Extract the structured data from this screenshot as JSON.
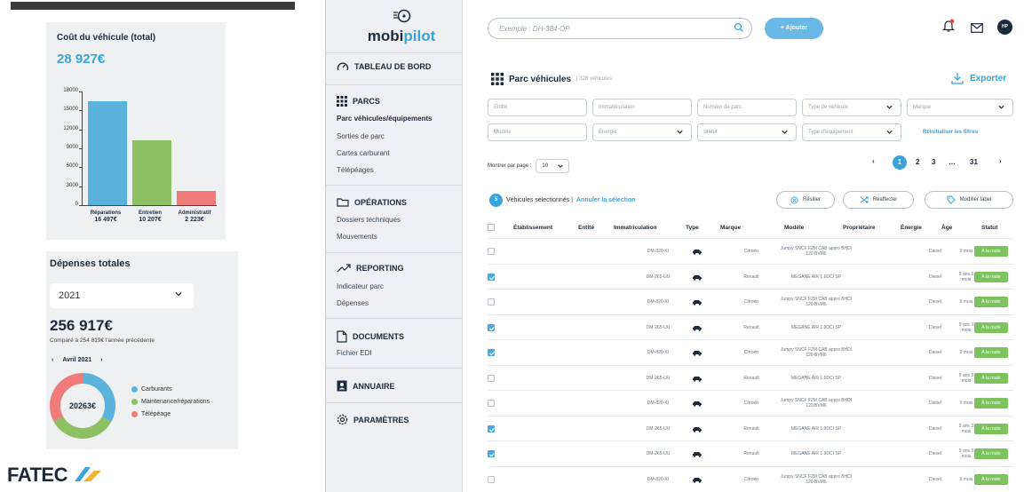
{
  "cost_card": {
    "title": "Coût du véhicule (total)",
    "total": "28 927€",
    "y_ticks": [
      "18000",
      "15000",
      "12000",
      "9000",
      "6000",
      "3000",
      "0"
    ]
  },
  "chart_data": {
    "type": "bar",
    "categories": [
      "Réparations",
      "Entretien",
      "Administratif"
    ],
    "values": [
      16497,
      10207,
      2223
    ],
    "value_labels": [
      "16 497€",
      "10 207€",
      "2 223€"
    ],
    "colors": [
      "#5ab3dd",
      "#8cc063",
      "#ef7b7b"
    ],
    "ylim": [
      0,
      18000
    ],
    "title": "Coût du véhicule (total)",
    "xlabel": "",
    "ylabel": ""
  },
  "expenses_card": {
    "title": "Dépenses totales",
    "year": "2021",
    "total": "256 917€",
    "comparison": "Comparé à 254 819€ l'année précédente",
    "month": "Avril 2021",
    "prev_arrow": "‹",
    "next_arrow": "›",
    "donut_center": "20263€",
    "donut": [
      {
        "label": "Carburants",
        "color": "#5ab3dd",
        "fraction": 0.33
      },
      {
        "label": "Maintenance/réparations",
        "color": "#8cc063",
        "fraction": 0.34
      },
      {
        "label": "Télépéage",
        "color": "#ef7b7b",
        "fraction": 0.33
      }
    ]
  },
  "brand_footer": "FATEC",
  "app": {
    "logo_text_a": "mobi",
    "logo_text_b": "pilot",
    "search_placeholder": "Exemple : DH-384-OP",
    "add_label": "+ Ajouter",
    "avatar": "HP",
    "nav": {
      "dashboard": "TABLEAU DE BORD",
      "parcs": "PARCS",
      "parcs_items": [
        "Parc véhicules/équipements",
        "Sorties de parc",
        "Cartes carburant",
        "Télépéages"
      ],
      "operations": "OPÉRATIONS",
      "operations_items": [
        "Dossiers techniques",
        "Mouvements"
      ],
      "reporting": "REPORTING",
      "reporting_items": [
        "Indicateur parc",
        "Dépenses"
      ],
      "documents": "DOCUMENTS",
      "documents_items": [
        "Fichier EDI"
      ],
      "annuaire": "ANNUAIRE",
      "parametres": "PARAMÈTRES"
    },
    "fleet_title": "Parc véhicules",
    "fleet_count": "| 328 véhicules",
    "export": "Exporter",
    "filters": {
      "entite": "Entité",
      "immat": "Immatriculation",
      "num_parc": "Numéro de parc",
      "type_vehicule": "Type de véhicule",
      "marque": "Marque",
      "modele": "Modèle",
      "energie": "Énergie",
      "statut": "Statut",
      "type_equipement": "Type d'équipement",
      "reset": "Réinitialiser les filtres"
    },
    "per_page_label": "Montrer par page :",
    "per_page_value": "10",
    "pagination": {
      "prev": "‹",
      "p1": "1",
      "p2": "2",
      "p3": "3",
      "ellipsis": "…",
      "last": "31",
      "next": "›"
    },
    "selection": {
      "count": "5",
      "text": "Véhicules sélectionnés |",
      "cancel": "Annuler la sélection"
    },
    "actions": {
      "resilier": "Résilier",
      "reaffecter": "Réaffecter",
      "modifier": "Modifier label"
    },
    "columns": [
      "Établissement",
      "Entité",
      "Immatriculation",
      "Type",
      "Marque",
      "Modèle",
      "Propriétaire",
      "Énergie",
      "Âge",
      "Statut"
    ],
    "rows": [
      {
        "checked": false,
        "immat": "DM-820-KI",
        "marque": "Citroën",
        "modele": "Jumpy SNCF F2M CAB appro BHDI 120 BVM6",
        "energie": "Diesel",
        "age": "9 mois",
        "statut": "À la route"
      },
      {
        "checked": true,
        "immat": "DM-265-UU",
        "marque": "Renault",
        "modele": "MEGANE AIR 1.9DCI SP",
        "energie": "Diesel",
        "age": "9 ans 3 mois",
        "statut": "À la route"
      },
      {
        "checked": false,
        "immat": "DM-820-KI",
        "marque": "Citroën",
        "modele": "Jumpy SNCF F2M CAB appro BHDI 120 BVM6",
        "energie": "Diesel",
        "age": "9 mois",
        "statut": "À la route"
      },
      {
        "checked": true,
        "immat": "DM-265-UU",
        "marque": "Renault",
        "modele": "MEGANE AIR 1.9DCI SP",
        "energie": "Diesel",
        "age": "9 ans 3 mois",
        "statut": "À la route"
      },
      {
        "checked": true,
        "immat": "DM-820-KI",
        "marque": "Citroën",
        "modele": "Jumpy SNCF F2M CAB appro BHDI 120 BVM6",
        "energie": "Diesel",
        "age": "9 mois",
        "statut": "À la route"
      },
      {
        "checked": false,
        "immat": "DM-265-UU",
        "marque": "Renault",
        "modele": "MEGANE AIR 1.9DCI SP",
        "energie": "Diesel",
        "age": "9 ans 3 mois",
        "statut": "À la route"
      },
      {
        "checked": false,
        "immat": "DM-820-KI",
        "marque": "Citroën",
        "modele": "Jumpy SNCF F2M CAB appro BHDI 120 BVM6",
        "energie": "Diesel",
        "age": "9 mois",
        "statut": "À la route"
      },
      {
        "checked": true,
        "immat": "DM-265-UU",
        "marque": "Renault",
        "modele": "MEGANE AIR 1.9DCI SP",
        "energie": "Diesel",
        "age": "9 ans 3 mois",
        "statut": "À la route"
      },
      {
        "checked": true,
        "immat": "DM-265-UU",
        "marque": "Renault",
        "modele": "MEGANE AIR 1.9DCI SP",
        "energie": "Diesel",
        "age": "9 ans 3 mois",
        "statut": "À la route"
      },
      {
        "checked": false,
        "immat": "DM-820-KI",
        "marque": "Citroën",
        "modele": "Jumpy SNCF F2M CAB appro BHDI 120 BVM6",
        "energie": "Diesel",
        "age": "9 mois",
        "statut": "À la route"
      }
    ]
  }
}
